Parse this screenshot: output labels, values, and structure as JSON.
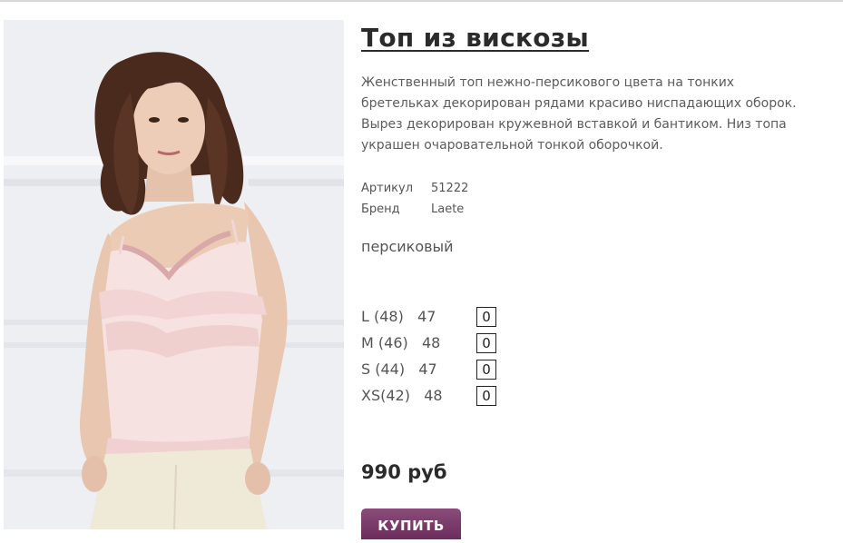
{
  "product": {
    "title": "Топ из вискозы",
    "description": "Женственный топ нежно-персикового цвета на тонких бретельках декорирован рядами красиво ниспадающих оборок. Вырез декорирован кружевной вставкой и бантиком. Низ топа украшен очаровательной тонкой оборочкой.",
    "attributes": [
      {
        "key": "Артикул",
        "value": "51222"
      },
      {
        "key": "Бренд",
        "value": "Laete"
      }
    ],
    "color": "персиковый",
    "sizes": [
      {
        "label": "L (48)   47",
        "qty": "0"
      },
      {
        "label": "M (46)   48",
        "qty": "0"
      },
      {
        "label": "S (44)   47",
        "qty": "0"
      },
      {
        "label": "XS(42)   48",
        "qty": "0"
      }
    ],
    "price": "990 руб",
    "buy_label": "КУПИТЬ"
  },
  "colors": {
    "buy_button": "#7a3b6b",
    "top_garment": "#f7e2e2",
    "hair": "#4a2a1c"
  }
}
